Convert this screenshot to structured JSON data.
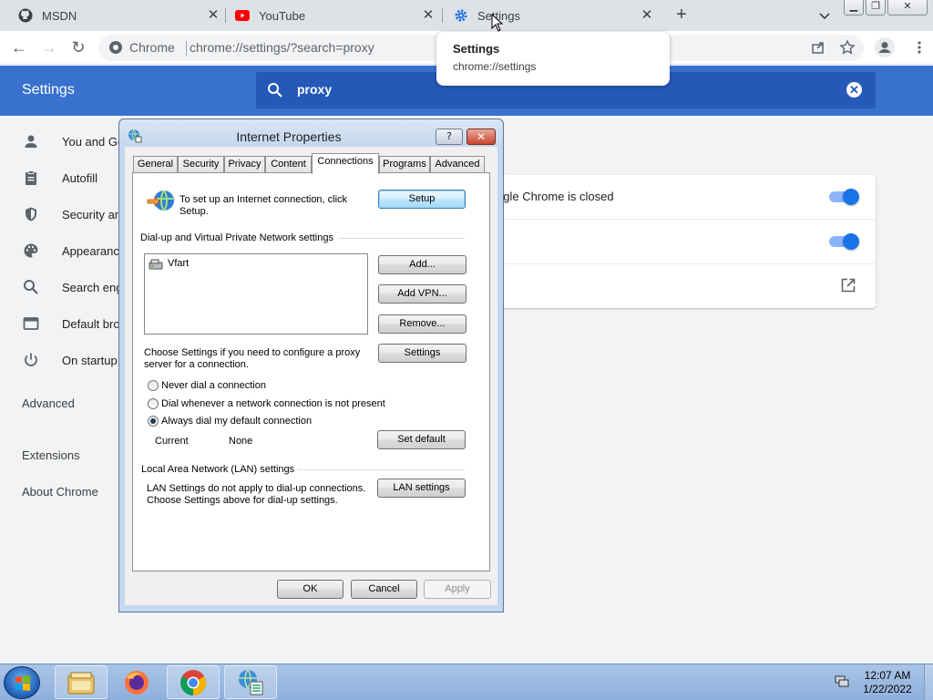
{
  "browser": {
    "tabs": [
      {
        "title": "MSDN",
        "icon": "github-icon"
      },
      {
        "title": "YouTube",
        "icon": "youtube-icon"
      },
      {
        "title": "Settings",
        "icon": "gear-icon"
      }
    ],
    "new_tab": "+",
    "omnibox": {
      "chip": "Chrome",
      "url": "chrome://settings/?search=proxy"
    },
    "hover_card": {
      "title": "Settings",
      "url": "chrome://settings"
    }
  },
  "settings": {
    "title": "Settings",
    "search_value": "proxy",
    "clear_label": "✕",
    "nav": [
      {
        "label": "You and Go",
        "icon": "person-icon"
      },
      {
        "label": "Autofill",
        "icon": "clipboard-icon"
      },
      {
        "label": "Security an",
        "icon": "shield-icon"
      },
      {
        "label": "Appearanc",
        "icon": "palette-icon"
      },
      {
        "label": "Search eng",
        "icon": "search-icon"
      },
      {
        "label": "Default bro",
        "icon": "browser-icon"
      },
      {
        "label": "On startup",
        "icon": "power-icon"
      }
    ],
    "advanced_label": "Advanced",
    "extensions_label": "Extensions",
    "about_label": "About Chrome",
    "card_rows": [
      {
        "text": "ogle Chrome is closed",
        "control": "toggle-on"
      },
      {
        "text": "",
        "control": "toggle-on"
      },
      {
        "text": "",
        "control": "external-link"
      }
    ]
  },
  "dialog": {
    "title": "Internet Properties",
    "help_label": "?",
    "close_label": "✕",
    "tabs": [
      "General",
      "Security",
      "Privacy",
      "Content",
      "Connections",
      "Programs",
      "Advanced"
    ],
    "active_tab": "Connections",
    "setup_text_1": "To set up an Internet connection, click",
    "setup_text_2": "Setup.",
    "setup_button": "Setup",
    "dialup_group": "Dial-up and Virtual Private Network settings",
    "connections": [
      "Vfart"
    ],
    "add_button": "Add...",
    "add_vpn_button": "Add VPN...",
    "remove_button": "Remove...",
    "settings_text_1": "Choose Settings if you need to configure a proxy",
    "settings_text_2": "server for a connection.",
    "settings_button": "Settings",
    "radios": [
      {
        "label": "Never dial a connection",
        "checked": false
      },
      {
        "label": "Dial whenever a network connection is not present",
        "checked": false
      },
      {
        "label": "Always dial my default connection",
        "checked": true
      }
    ],
    "current_label": "Current",
    "current_value": "None",
    "set_default_button": "Set default",
    "lan_group": "Local Area Network (LAN) settings",
    "lan_text_1": "LAN Settings do not apply to dial-up connections.",
    "lan_text_2": "Choose Settings above for dial-up settings.",
    "lan_button": "LAN settings",
    "ok_button": "OK",
    "cancel_button": "Cancel",
    "apply_button": "Apply"
  },
  "taskbar": {
    "items": [
      "explorer-icon",
      "firefox-icon",
      "chrome-icon",
      "internet-options-icon"
    ],
    "time": "12:07 AM",
    "date": "1/22/2022"
  },
  "colors": {
    "settings_header": "#3871ce",
    "accent": "#1a73e8",
    "taskbar": "#9db9df"
  }
}
